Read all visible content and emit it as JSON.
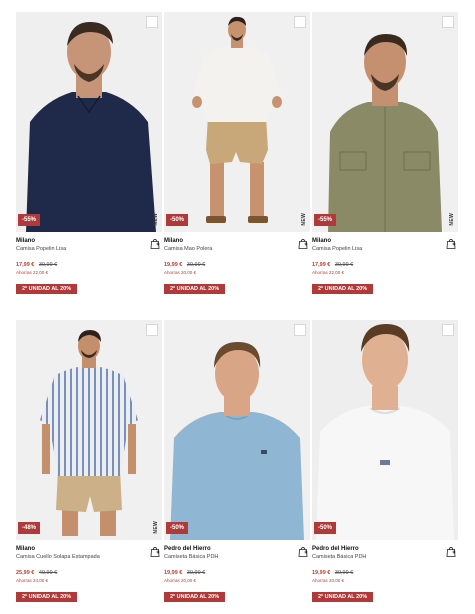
{
  "products": [
    {
      "brand": "Milano",
      "name": "Camisa Popelin Lisa",
      "price": "17,99 €",
      "old_price": "39,99 €",
      "savings": "Ahorras 22,00 €",
      "discount": "-55%",
      "promo": "2ª UNIDAD AL 20%",
      "new_tag": "NEW",
      "shirt_color": "#1f2a4a"
    },
    {
      "brand": "Milano",
      "name": "Camisa Mao Polera",
      "price": "19,99 €",
      "old_price": "39,99 €",
      "savings": "Ahorras 20,00 €",
      "discount": "-50%",
      "promo": "2ª UNIDAD AL 20%",
      "new_tag": "NEW",
      "shirt_color": "#f4f2ee"
    },
    {
      "brand": "Milano",
      "name": "Camisa Popelin Lisa",
      "price": "17,99 €",
      "old_price": "39,99 €",
      "savings": "Ahorras 22,00 €",
      "discount": "-55%",
      "promo": "2ª UNIDAD AL 20%",
      "new_tag": "NEW",
      "shirt_color": "#8a8a66"
    },
    {
      "brand": "Milano",
      "name": "Camisa Cuello Solapa Estampada",
      "price": "25,99 €",
      "old_price": "49,99 €",
      "savings": "Ahorras 24,00 €",
      "discount": "-48%",
      "promo": "2ª UNIDAD AL 20%",
      "new_tag": "NEW",
      "shirt_color": "#c9d3e3"
    },
    {
      "brand": "Pedro del Hierro",
      "name": "Camiseta Básica PDH",
      "price": "19,99 €",
      "old_price": "39,99 €",
      "savings": "Ahorras 20,00 €",
      "discount": "-50%",
      "promo": "2ª UNIDAD AL 20%",
      "new_tag": "",
      "shirt_color": "#8fb7d4"
    },
    {
      "brand": "Pedro del Hierro",
      "name": "Camiseta Básica PDH",
      "price": "19,99 €",
      "old_price": "39,99 €",
      "savings": "Ahorras 20,00 €",
      "discount": "-50%",
      "promo": "2ª UNIDAD AL 20%",
      "new_tag": "",
      "shirt_color": "#f7f7f7"
    }
  ]
}
